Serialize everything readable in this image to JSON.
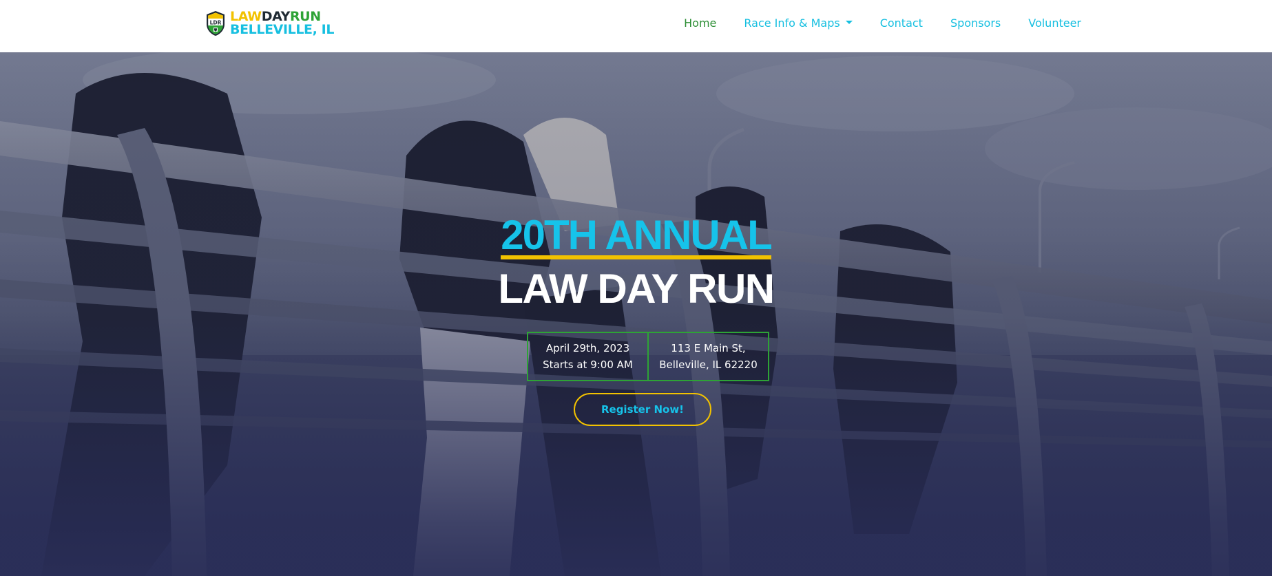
{
  "brand": {
    "badge_text": "LDR",
    "line1_law": "LAW",
    "line1_day": "DAY",
    "line1_run": "RUN",
    "line2": "BELLEVILLE, IL"
  },
  "nav": {
    "items": [
      {
        "label": "Home",
        "active": true
      },
      {
        "label": "Race Info & Maps",
        "dropdown": true
      },
      {
        "label": "Contact"
      },
      {
        "label": "Sponsors"
      },
      {
        "label": "Volunteer"
      }
    ]
  },
  "hero": {
    "kicker": "20TH ANNUAL",
    "title": "LAW DAY RUN",
    "date_line1": "April 29th, 2023",
    "date_line2": "Starts at 9:00 AM",
    "address_line1": "113 E Main St,",
    "address_line2": "Belleville, IL 62220",
    "cta": "Register Now!"
  },
  "colors": {
    "brand_blue": "#16bfe0",
    "brand_yellow": "#f2c200",
    "brand_green": "#2ea336",
    "nav_active": "#2e8f36",
    "overlay_navy": "#2a2f55"
  }
}
